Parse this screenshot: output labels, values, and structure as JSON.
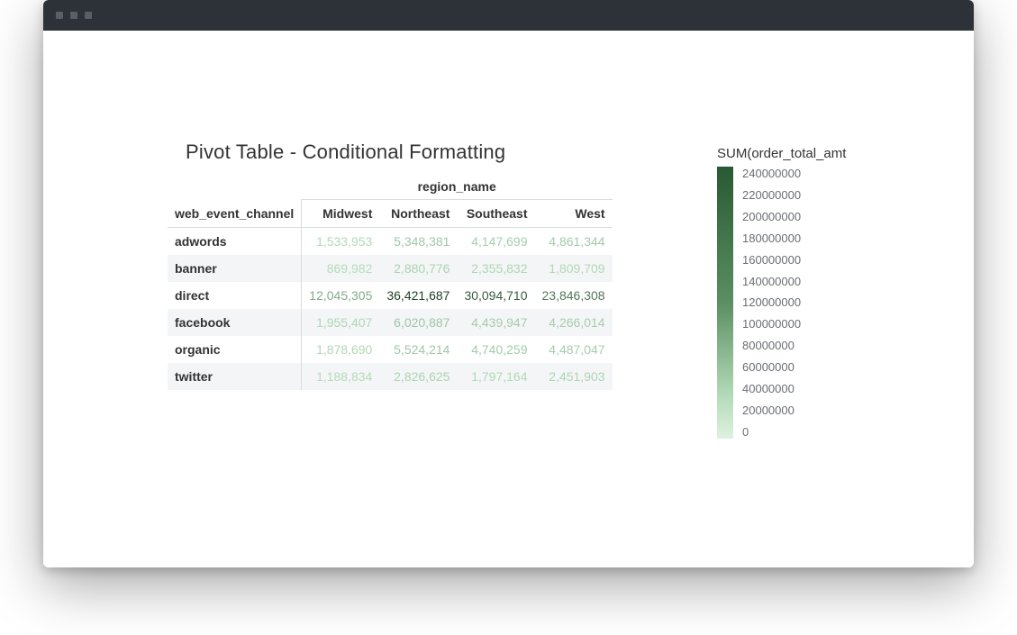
{
  "title": "Pivot Table - Conditional Formatting",
  "pivot": {
    "super_column": "region_name",
    "row_dim_label": "web_event_channel",
    "columns": [
      "Midwest",
      "Northeast",
      "Southeast",
      "West"
    ],
    "rows": [
      {
        "label": "adwords",
        "values_raw": [
          1533953,
          5348381,
          4147699,
          4861344
        ],
        "values": [
          "1,533,953",
          "5,348,381",
          "4,147,699",
          "4,861,344"
        ]
      },
      {
        "label": "banner",
        "values_raw": [
          869982,
          2880776,
          2355832,
          1809709
        ],
        "values": [
          "869,982",
          "2,880,776",
          "2,355,832",
          "1,809,709"
        ]
      },
      {
        "label": "direct",
        "values_raw": [
          12045305,
          36421687,
          30094710,
          23846308
        ],
        "values": [
          "12,045,305",
          "36,421,687",
          "30,094,710",
          "23,846,308"
        ]
      },
      {
        "label": "facebook",
        "values_raw": [
          1955407,
          6020887,
          4439947,
          4266014
        ],
        "values": [
          "1,955,407",
          "6,020,887",
          "4,439,947",
          "4,266,014"
        ]
      },
      {
        "label": "organic",
        "values_raw": [
          1878690,
          5524214,
          4740259,
          4487047
        ],
        "values": [
          "1,878,690",
          "5,524,214",
          "4,740,259",
          "4,487,047"
        ]
      },
      {
        "label": "twitter",
        "values_raw": [
          1188834,
          2826625,
          1797164,
          2451903
        ],
        "values": [
          "1,188,834",
          "2,826,625",
          "1,797,164",
          "2,451,903"
        ]
      }
    ]
  },
  "legend": {
    "title": "SUM(order_total_amt",
    "ticks": [
      "240000000",
      "220000000",
      "200000000",
      "180000000",
      "160000000",
      "140000000",
      "120000000",
      "100000000",
      "80000000",
      "60000000",
      "40000000",
      "20000000",
      "0"
    ],
    "colors": {
      "top": "#285a33",
      "bottom": "#dff1e0"
    }
  },
  "scale": {
    "min": 0,
    "max": 240000000,
    "light": "#b5dcba",
    "dark": "#1d3f26"
  },
  "chart_data": {
    "type": "heatmap",
    "title": "Pivot Table - Conditional Formatting",
    "value_metric": "SUM(order_total_amt)",
    "row_dimension": "web_event_channel",
    "column_dimension": "region_name",
    "columns": [
      "Midwest",
      "Northeast",
      "Southeast",
      "West"
    ],
    "rows": [
      "adwords",
      "banner",
      "direct",
      "facebook",
      "organic",
      "twitter"
    ],
    "values": [
      [
        1533953,
        5348381,
        4147699,
        4861344
      ],
      [
        869982,
        2880776,
        2355832,
        1809709
      ],
      [
        12045305,
        36421687,
        30094710,
        23846308
      ],
      [
        1955407,
        6020887,
        4439947,
        4266014
      ],
      [
        1878690,
        5524214,
        4740259,
        4487047
      ],
      [
        1188834,
        2826625,
        1797164,
        2451903
      ]
    ],
    "color_scale": {
      "min": 0,
      "max": 240000000,
      "palette": [
        "#dff1e0",
        "#285a33"
      ]
    },
    "legend_position": "right"
  }
}
